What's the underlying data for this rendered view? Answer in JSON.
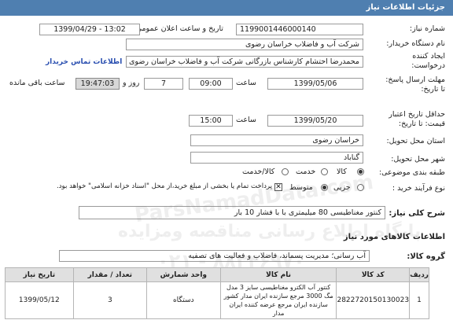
{
  "header": {
    "title": "جزئیات اطلاعات نیاز"
  },
  "fields": {
    "need_number_label": "شماره نیاز:",
    "need_number": "1199001446000140",
    "announce_label": "تاریخ و ساعت اعلان عمومی:",
    "announce_value": "1399/04/29 - 13:02",
    "buyer_label": "نام دستگاه خریدار:",
    "buyer_value": "شرکت آب و فاضلاب خراسان رضوی",
    "creator_label_1": "ایجاد کننده",
    "creator_label_2": "درخواست:",
    "creator_value": "محمدرضا احتشام کارشناس بازرگانی شرکت آب و فاضلاب خراسان رضوی",
    "contact_link": "اطلاعات تماس خریدار",
    "deadline_label_1": "مهلت ارسال پاسخ:",
    "deadline_label_2": "تا تاریخ:",
    "deadline_date": "1399/05/06",
    "time_label": "ساعت",
    "deadline_time": "09:00",
    "days_value": "7",
    "days_label": "روز و",
    "remaining_value": "19:47:03",
    "remaining_label": "ساعت باقی مانده",
    "validity_label_1": "حداقل تاریخ اعتبار",
    "validity_label_2": "قیمت: تا تاریخ:",
    "validity_date": "1399/05/20",
    "validity_time": "15:00",
    "province_label": "استان محل تحویل:",
    "province_value": "خراسان رضوی",
    "city_label": "شهر محل تحویل:",
    "city_value": "گناباد",
    "category_label": "طبقه بندی موضوعی:",
    "category_options": [
      "کالا",
      "خدمت",
      "کالا/خدمت"
    ],
    "process_label": "نوع فرآیند خرید :",
    "process_options": [
      "جزیی",
      "متوسط"
    ],
    "payment_note": "پرداخت تمام یا بخشی از مبلغ خرید،از محل \"اسناد خزانه اسلامی\" خواهد بود."
  },
  "summary": {
    "label": "شرح کلی نیاز:",
    "value": "کنتور مغناطیسی 80 میلیمتری با با فشار 10 بار"
  },
  "goods_section": {
    "title": "اطلاعات کالاهای مورد نیاز"
  },
  "group": {
    "label": "گروه کالا:",
    "value": "آب رسانی؛ مدیریت پسماند، فاضلاب و فعالیت های تصفیه"
  },
  "table": {
    "headers": [
      "ردیف",
      "کد کالا",
      "نام کالا",
      "واحد شمارش",
      "تعداد / مقدار",
      "تاریخ نیاز"
    ],
    "rows": [
      {
        "row": "1",
        "code": "2822720150130023",
        "name": "کنتور آب الکترو مغناطیسی سایز 3 مدل مگ 3000 مرجع سازنده ایران مدار کشور سازنده ایران مرجع عرضه کننده ایران مدار",
        "unit": "دستگاه",
        "qty": "3",
        "date": "1399/05/12"
      }
    ]
  },
  "watermark": {
    "line1": "ParsNamadData.com",
    "line2": "پایگاه اطلاع رسانی مناقصه ومزایده",
    "line3": "۰۲۱ - ۸۸۳۴۶۹۷۰"
  }
}
